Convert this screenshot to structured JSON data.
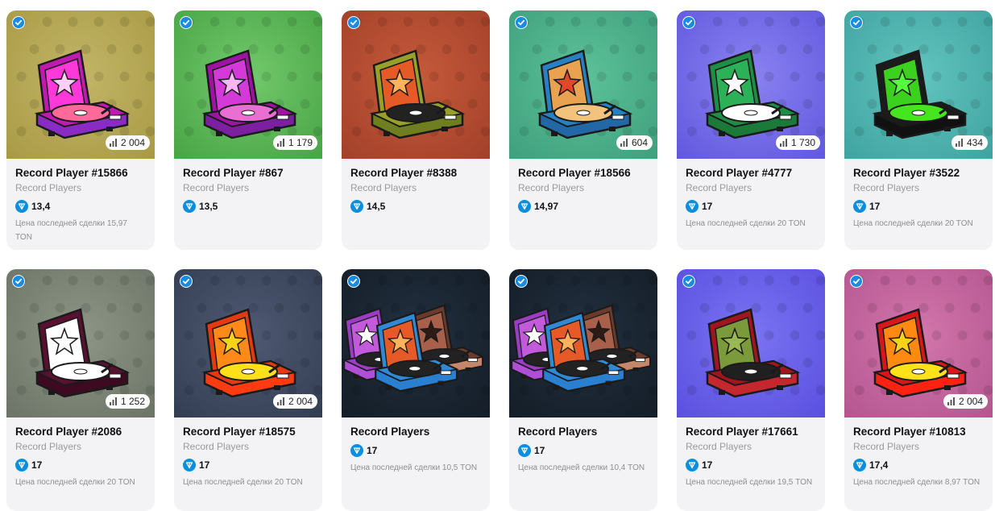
{
  "last_sale_prefix": "Цена последней сделки",
  "cards": [
    {
      "title": "Record Player #15866",
      "collection": "Record Players",
      "price": "13,4",
      "last_sale": "Цена последней сделки 15,97 TON",
      "count": "2 004",
      "bg1": "#c2b567",
      "bg2": "#a89a45",
      "lid": "#c01ab3",
      "inner": "#ff38d9",
      "star": "#ffd0f5",
      "disc": "#ff6a9a",
      "base": "#8a2cc4",
      "multi": false
    },
    {
      "title": "Record Player #867",
      "collection": "Record Players",
      "price": "13,5",
      "last_sale": "",
      "count": "1 179",
      "bg1": "#72c96c",
      "bg2": "#48a445",
      "lid": "#a012a3",
      "inner": "#d43ad8",
      "star": "#f6b6f7",
      "disc": "#e96fd2",
      "base": "#7c1fa0",
      "multi": false
    },
    {
      "title": "Record Player #8388",
      "collection": "Record Players",
      "price": "14,5",
      "last_sale": "",
      "count": "",
      "bg1": "#c65a3a",
      "bg2": "#a2402a",
      "lid": "#97a12a",
      "inner": "#e65a27",
      "star": "#ffb35a",
      "disc": "#222222",
      "base": "#6f7e1e",
      "multi": false
    },
    {
      "title": "Record Player #18566",
      "collection": "Record Players",
      "price": "14,97",
      "last_sale": "",
      "count": "604",
      "bg1": "#5cc199",
      "bg2": "#3ea07d",
      "lid": "#2680c2",
      "inner": "#e9a24f",
      "star": "#e8442a",
      "disc": "#f1c37c",
      "base": "#2368a6",
      "multi": false
    },
    {
      "title": "Record Player #4777",
      "collection": "Record Players",
      "price": "17",
      "last_sale": "Цена последней сделки 20 TON",
      "count": "1 730",
      "bg1": "#8a83f0",
      "bg2": "#6157df",
      "lid": "#1f8d45",
      "inner": "#2db158",
      "star": "#ffffff",
      "disc": "#ffffff",
      "base": "#1b7a3a",
      "multi": false
    },
    {
      "title": "Record Player #3522",
      "collection": "Record Players",
      "price": "17",
      "last_sale": "Цена последней сделки 20 TON",
      "count": "434",
      "bg1": "#63c4bf",
      "bg2": "#3fa39f",
      "lid": "#1b1b1b",
      "inner": "#3dd11f",
      "star": "#56ff3d",
      "disc": "#46e61f",
      "base": "#111111",
      "multi": false
    },
    {
      "title": "Record Player #2086",
      "collection": "Record Players",
      "price": "17",
      "last_sale": "Цена последней сделки 20 TON",
      "count": "1 252",
      "bg1": "#8d9686",
      "bg2": "#6c7467",
      "lid": "#5a1030",
      "inner": "#ffffff",
      "star": "#ffffff",
      "disc": "#ffffff",
      "base": "#3e0a22",
      "multi": false
    },
    {
      "title": "Record Player #18575",
      "collection": "Record Players",
      "price": "17",
      "last_sale": "Цена последней сделки 20 TON",
      "count": "2 004",
      "bg1": "#4f5a73",
      "bg2": "#333d52",
      "lid": "#e43a12",
      "inner": "#ff8a1a",
      "star": "#ffd21a",
      "disc": "#ffe01a",
      "base": "#ff3b12",
      "multi": false
    },
    {
      "title": "Record Players",
      "collection": "",
      "price": "17",
      "last_sale": "Цена последней сделки 10,5 TON",
      "count": "",
      "bg1": "#22303f",
      "bg2": "#141d27",
      "lid": "#2e8ad6",
      "inner": "#e65a27",
      "star": "#ffb35a",
      "disc": "#222222",
      "base": "#2b7fd0",
      "multi": true
    },
    {
      "title": "Record Players",
      "collection": "",
      "price": "17",
      "last_sale": "Цена последней сделки 10,4 TON",
      "count": "",
      "bg1": "#22303f",
      "bg2": "#141d27",
      "lid": "#2e8ad6",
      "inner": "#e65a27",
      "star": "#ffb35a",
      "disc": "#222222",
      "base": "#2b7fd0",
      "multi": true
    },
    {
      "title": "Record Player #17661",
      "collection": "Record Players",
      "price": "17",
      "last_sale": "Цена последней сделки 19,5 TON",
      "count": "",
      "bg1": "#7a74f2",
      "bg2": "#5a4fe0",
      "lid": "#a11520",
      "inner": "#7a9a3c",
      "star": "#9ab852",
      "disc": "#202020",
      "base": "#c4272e",
      "multi": false
    },
    {
      "title": "Record Player #10813",
      "collection": "Record Players",
      "price": "17,4",
      "last_sale": "Цена последней сделки 8,97 TON",
      "count": "2 004",
      "bg1": "#d276ad",
      "bg2": "#b4558f",
      "lid": "#d8171a",
      "inner": "#ff8a12",
      "star": "#ffd21a",
      "disc": "#ffe21a",
      "base": "#ff2212",
      "multi": false
    }
  ]
}
